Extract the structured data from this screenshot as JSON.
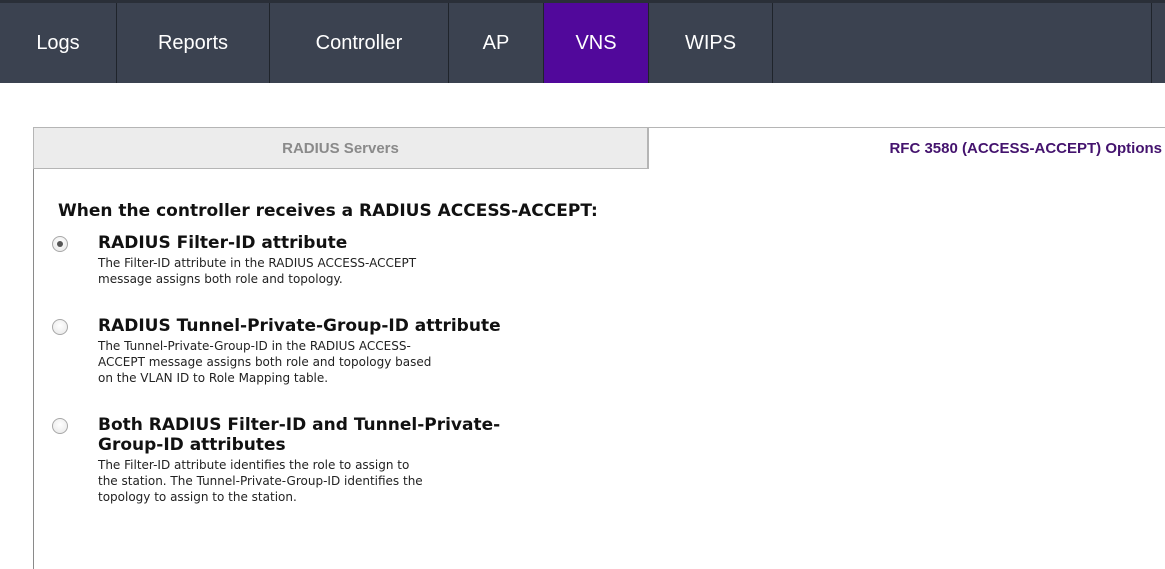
{
  "nav": {
    "items": [
      {
        "label": "Logs"
      },
      {
        "label": "Reports"
      },
      {
        "label": "Controller"
      },
      {
        "label": "AP"
      },
      {
        "label": "VNS",
        "active": true
      },
      {
        "label": "WIPS"
      }
    ]
  },
  "tabs": {
    "radius_servers": "RADIUS Servers",
    "rfc_options": "RFC 3580 (ACCESS-ACCEPT) Options"
  },
  "panel": {
    "heading": "When the controller receives a RADIUS ACCESS-ACCEPT:",
    "options": [
      {
        "title": "RADIUS Filter-ID attribute",
        "desc_lines": [
          "The Filter-ID attribute in the RADIUS ACCESS-ACCEPT",
          "message assigns both role and topology."
        ],
        "checked": true
      },
      {
        "title": "RADIUS Tunnel-Private-Group-ID attribute",
        "desc_lines": [
          "The Tunnel-Private-Group-ID in the RADIUS ACCESS-",
          "ACCEPT message assigns both role and topology based",
          "on the VLAN ID to Role Mapping table."
        ],
        "checked": false
      },
      {
        "title_lines": [
          "Both RADIUS Filter-ID and Tunnel-Private-",
          "Group-ID attributes"
        ],
        "desc_lines": [
          "The Filter-ID attribute identifies the role to assign to",
          "the station. The Tunnel-Private-Group-ID identifies the",
          "topology to assign to the station."
        ],
        "checked": false
      }
    ]
  },
  "colors": {
    "nav_bg": "#3b4250",
    "nav_active": "#51089b",
    "tab_active_text": "#44136e"
  }
}
